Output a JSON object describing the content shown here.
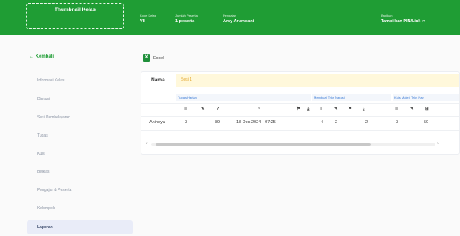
{
  "header": {
    "thumbnail_label": "Thumbnail Kelas",
    "kode_kelas": {
      "label": "Kode Kelas",
      "value": "VII"
    },
    "jumlah_peserta": {
      "label": "Jumlah Peserta",
      "value": "1 peserta"
    },
    "pengajar": {
      "label": "Pengajar",
      "value": "Arsy Arumdani"
    },
    "bagikan": {
      "label": "Bagikan",
      "value": "Tampilkan PIN/Link"
    },
    "accent": "#1f9d34"
  },
  "sidebar": {
    "back": "Kembali",
    "items": [
      {
        "label": "Informasi Kelas"
      },
      {
        "label": "Diskusi"
      },
      {
        "label": "Sesi Pembelajaran"
      },
      {
        "label": "Tugas"
      },
      {
        "label": "Kuis"
      },
      {
        "label": "Berkas"
      },
      {
        "label": "Pengajar & Peserta"
      },
      {
        "label": "Kelompok"
      },
      {
        "label": "Laporan",
        "active": true
      }
    ]
  },
  "excel": {
    "label": "Excel",
    "icon": "excel-icon"
  },
  "report": {
    "nama_label": "Nama",
    "sesi_label": "Sesi 1",
    "groups": [
      "Tugas Harian",
      "Membuat Teks Narasi",
      "Kuis Materi Teks Nar"
    ],
    "columns": [
      {
        "icon": "list-icon",
        "text": ""
      },
      {
        "icon": "pencil-icon",
        "text": ""
      },
      {
        "icon": "",
        "text": "?"
      },
      {
        "icon": "clock-icon",
        "text": ""
      },
      {
        "icon": "flag-icon",
        "text": ""
      },
      {
        "icon": "download-icon",
        "text": ""
      },
      {
        "icon": "list-icon",
        "text": ""
      },
      {
        "icon": "pencil-icon",
        "text": ""
      },
      {
        "icon": "flag-icon",
        "text": ""
      },
      {
        "icon": "download-icon",
        "text": ""
      },
      {
        "icon": "list-icon",
        "text": ""
      },
      {
        "icon": "pencil-icon",
        "text": ""
      },
      {
        "icon": "grid-icon",
        "text": ""
      }
    ],
    "rows": [
      {
        "name": "Anindya",
        "cells": [
          "3",
          "-",
          "89",
          "18 Des 2024 - 07:25",
          "-",
          "-",
          "4",
          "2",
          "-",
          "2",
          "3",
          "-",
          "50"
        ]
      }
    ]
  }
}
